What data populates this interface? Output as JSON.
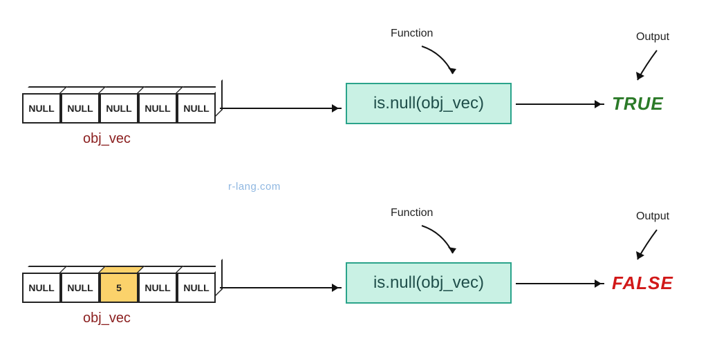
{
  "watermark": "r-lang.com",
  "labels": {
    "function": "Function",
    "output": "Output",
    "vec_name": "obj_vec"
  },
  "rows": [
    {
      "cells": [
        "NULL",
        "NULL",
        "NULL",
        "NULL",
        "NULL"
      ],
      "highlight_index": -1,
      "func_text": "is.null(obj_vec)",
      "output_value": "TRUE",
      "output_class": "out-true"
    },
    {
      "cells": [
        "NULL",
        "NULL",
        "5",
        "NULL",
        "NULL"
      ],
      "highlight_index": 2,
      "func_text": "is.null(obj_vec)",
      "output_value": "FALSE",
      "output_class": "out-false"
    }
  ],
  "chart_data": {
    "type": "table",
    "description": "Two examples of R is.null() on a vector named obj_vec",
    "examples": [
      {
        "obj_vec": [
          "NULL",
          "NULL",
          "NULL",
          "NULL",
          "NULL"
        ],
        "call": "is.null(obj_vec)",
        "result": "TRUE"
      },
      {
        "obj_vec": [
          "NULL",
          "NULL",
          5,
          "NULL",
          "NULL"
        ],
        "call": "is.null(obj_vec)",
        "result": "FALSE"
      }
    ]
  }
}
